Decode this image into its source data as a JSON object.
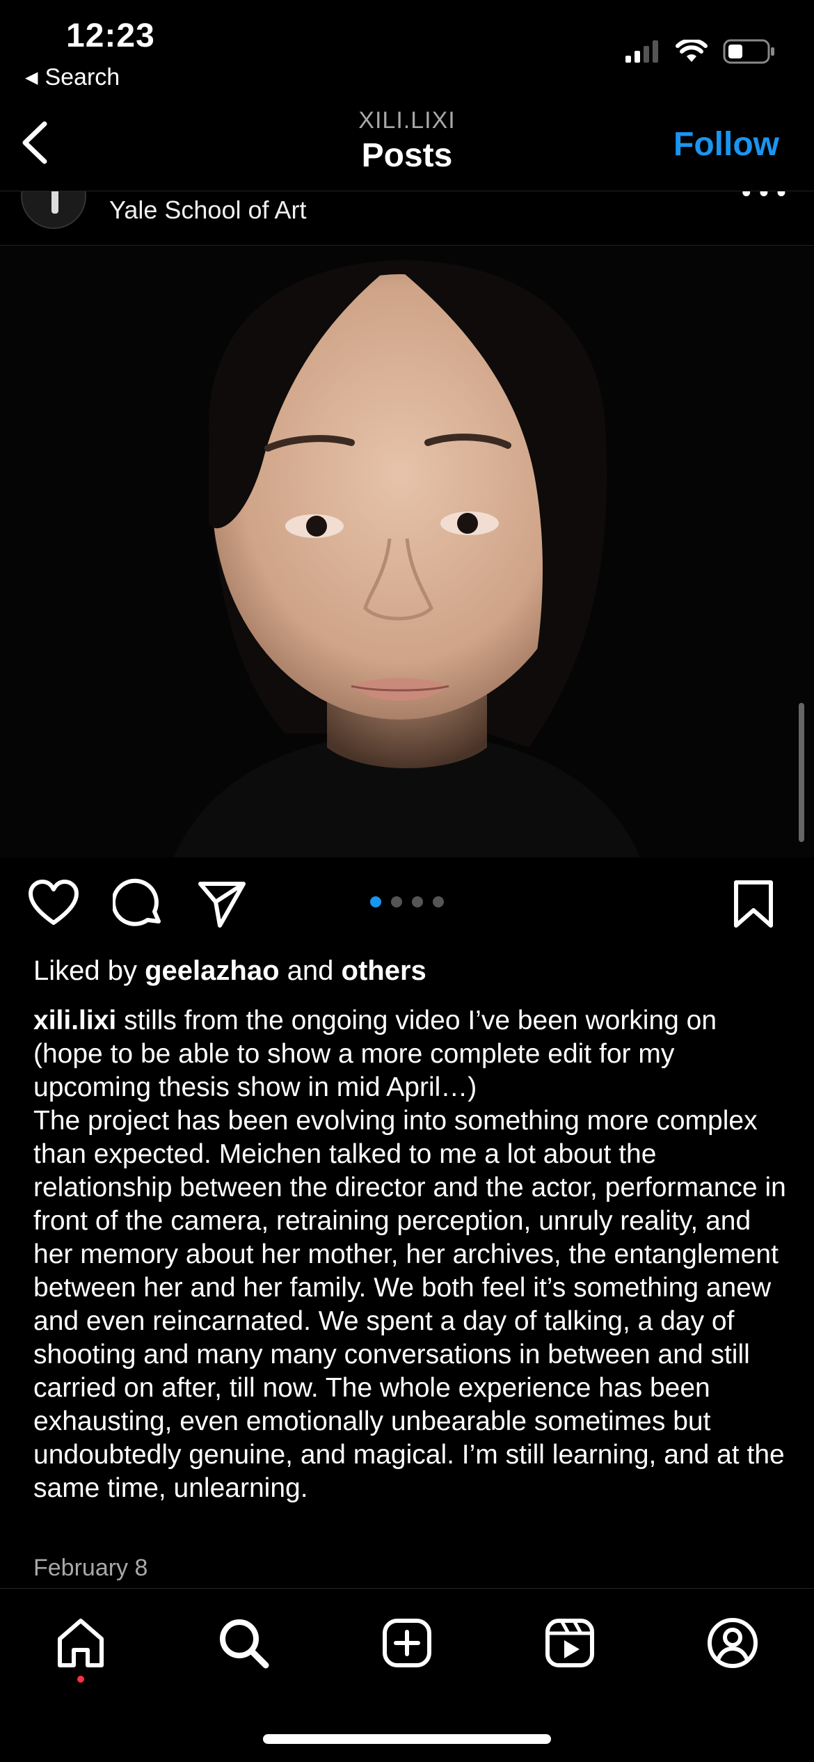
{
  "status_bar": {
    "time": "12:23",
    "back_app_label": "Search",
    "icons": [
      "cellular-signal-icon",
      "wifi-icon",
      "battery-icon"
    ]
  },
  "nav": {
    "username": "XILI.LIXI",
    "title": "Posts",
    "follow_label": "Follow",
    "follow_color": "#1a95f0"
  },
  "post": {
    "location": "Yale School of Art",
    "carousel": {
      "count": 4,
      "active_index": 0
    },
    "liked_prefix": "Liked by",
    "liked_user": "geelazhao",
    "liked_and": "and",
    "liked_others": "others",
    "caption_user": "xili.lixi",
    "caption_first": "stills from the ongoing video I’ve been working on (hope to be able to show a more complete edit for my upcoming thesis show in mid April…)",
    "caption_body": "The project has been evolving into something more complex than expected. Meichen talked to me a lot about the relationship between the director and the actor, performance in front of the camera, retraining perception, unruly reality, and her memory about her mother, her archives, the entanglement between her and her family. We both feel it’s something anew and even reincarnated. We spent a day of talking, a day of shooting and many many conversations in between and still carried on after, till now. The whole experience has been exhausting, even emotionally unbearable sometimes but undoubtedly genuine, and magical. I’m still learning, and at the same time, unlearning.",
    "date": "February 8"
  },
  "tab_bar": {
    "items": [
      "home-icon",
      "search-icon",
      "create-icon",
      "reels-icon",
      "profile-icon"
    ]
  }
}
